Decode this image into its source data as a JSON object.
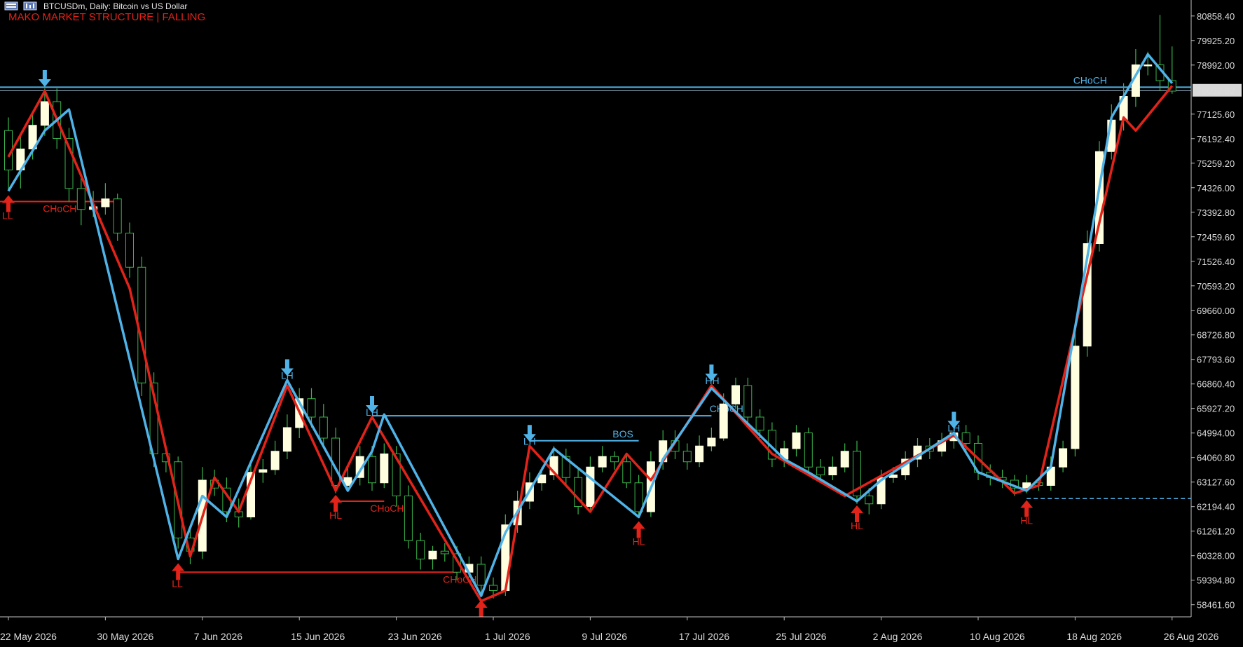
{
  "header": {
    "symbol_text": "BTCUSDm, Daily:  Bitcoin vs US Dollar",
    "indicator_text": "MAKO MARKET STRUCTURE | FALLING"
  },
  "colors": {
    "background": "#000000",
    "bull_candle": "#ffffe0",
    "bear_candle": "#000000",
    "wick": "#39b54a",
    "bull_line": "#4fb3e8",
    "bear_line": "#e2231a"
  },
  "chart_data": {
    "type": "candlestick",
    "price_scale": {
      "range": [
        58000,
        81200
      ],
      "labels": [
        "80858.40",
        "79925.20",
        "78992.00",
        "77125.60",
        "76192.40",
        "75259.20",
        "74326.00",
        "73392.80",
        "72459.60",
        "71526.40",
        "70593.20",
        "69660.00",
        "68726.80",
        "67793.60",
        "66860.40",
        "65927.20",
        "64994.00",
        "64060.80",
        "63127.60",
        "62194.40",
        "61261.20",
        "60328.00",
        "59394.80",
        "58461.60"
      ],
      "current_price": "78032.82"
    },
    "time_scale": {
      "labels": [
        {
          "i": 0,
          "text": "22 May 2026"
        },
        {
          "i": 8,
          "text": "30 May 2026"
        },
        {
          "i": 16,
          "text": "7 Jun 2026"
        },
        {
          "i": 24,
          "text": "15 Jun 2026"
        },
        {
          "i": 32,
          "text": "23 Jun 2026"
        },
        {
          "i": 40,
          "text": "1 Jul 2026"
        },
        {
          "i": 48,
          "text": "9 Jul 2026"
        },
        {
          "i": 56,
          "text": "17 Jul 2026"
        },
        {
          "i": 64,
          "text": "25 Jul 2026"
        },
        {
          "i": 72,
          "text": "2 Aug 2026"
        },
        {
          "i": 80,
          "text": "10 Aug 2026"
        },
        {
          "i": 88,
          "text": "18 Aug 2026"
        },
        {
          "i": 96,
          "text": "26 Aug 2026"
        }
      ]
    },
    "candles": [
      [
        76500,
        75000,
        77000,
        74200
      ],
      [
        75000,
        75800,
        76400,
        74300
      ],
      [
        75800,
        76700,
        77100,
        75400
      ],
      [
        76700,
        77600,
        78100,
        76300
      ],
      [
        77600,
        76200,
        78100,
        75800
      ],
      [
        76200,
        74300,
        76600,
        73800
      ],
      [
        74300,
        73500,
        74700,
        72900
      ],
      [
        73500,
        73600,
        74200,
        73200
      ],
      [
        73600,
        73900,
        74500,
        73300
      ],
      [
        73900,
        72600,
        74100,
        72300
      ],
      [
        72600,
        71300,
        73000,
        70900
      ],
      [
        71300,
        66900,
        71700,
        66400
      ],
      [
        66900,
        64200,
        67300,
        63700
      ],
      [
        64200,
        63900,
        64500,
        63500
      ],
      [
        63900,
        61000,
        64100,
        60600
      ],
      [
        61000,
        60500,
        61400,
        60000
      ],
      [
        60500,
        63200,
        63700,
        60200
      ],
      [
        63200,
        62900,
        63600,
        62600
      ],
      [
        62900,
        62000,
        63300,
        61600
      ],
      [
        62000,
        61800,
        62500,
        61400
      ],
      [
        61800,
        63500,
        63900,
        61700
      ],
      [
        63500,
        63600,
        64000,
        63100
      ],
      [
        63600,
        64300,
        64700,
        63400
      ],
      [
        64300,
        65200,
        65700,
        64000
      ],
      [
        65200,
        66300,
        66700,
        64800
      ],
      [
        66300,
        65600,
        66700,
        65200
      ],
      [
        65600,
        64800,
        66100,
        64500
      ],
      [
        64800,
        63000,
        65200,
        62700
      ],
      [
        63000,
        63300,
        63700,
        62800
      ],
      [
        63300,
        64100,
        64500,
        63000
      ],
      [
        64100,
        63100,
        64500,
        62800
      ],
      [
        63100,
        64200,
        64600,
        62900
      ],
      [
        64200,
        62600,
        64500,
        62200
      ],
      [
        62600,
        60900,
        63000,
        60600
      ],
      [
        60900,
        60200,
        61200,
        59800
      ],
      [
        60200,
        60500,
        60700,
        59800
      ],
      [
        60500,
        60400,
        60800,
        60100
      ],
      [
        60400,
        59700,
        60700,
        59400
      ],
      [
        59700,
        60000,
        60300,
        59500
      ],
      [
        60000,
        59200,
        60300,
        58800
      ],
      [
        59200,
        59000,
        59500,
        58700
      ],
      [
        59000,
        61500,
        61900,
        58800
      ],
      [
        61500,
        62400,
        62800,
        61200
      ],
      [
        62400,
        63100,
        63500,
        62100
      ],
      [
        63100,
        63400,
        63700,
        62800
      ],
      [
        63400,
        64100,
        64500,
        63200
      ],
      [
        64100,
        63300,
        64400,
        63000
      ],
      [
        63300,
        62200,
        63600,
        61900
      ],
      [
        62200,
        63700,
        64100,
        62000
      ],
      [
        63700,
        64100,
        64500,
        63500
      ],
      [
        64100,
        63900,
        64300,
        63600
      ],
      [
        63900,
        63100,
        64200,
        62900
      ],
      [
        63100,
        62000,
        63400,
        61800
      ],
      [
        62000,
        63900,
        64300,
        61800
      ],
      [
        63900,
        64700,
        65100,
        63600
      ],
      [
        64700,
        64300,
        65100,
        64000
      ],
      [
        64300,
        63900,
        64600,
        63600
      ],
      [
        63900,
        64500,
        64900,
        63700
      ],
      [
        64500,
        64800,
        65200,
        64300
      ],
      [
        64800,
        66100,
        66500,
        64700
      ],
      [
        66100,
        66800,
        67100,
        65900
      ],
      [
        66800,
        65600,
        67100,
        65200
      ],
      [
        65600,
        65100,
        65900,
        64800
      ],
      [
        65100,
        64000,
        65400,
        63700
      ],
      [
        64000,
        64400,
        64700,
        63700
      ],
      [
        64400,
        65000,
        65300,
        64100
      ],
      [
        65000,
        63700,
        65200,
        63400
      ],
      [
        63700,
        63400,
        64000,
        63100
      ],
      [
        63400,
        63700,
        64100,
        63200
      ],
      [
        63700,
        64300,
        64600,
        63500
      ],
      [
        64300,
        62600,
        64700,
        62300
      ],
      [
        62600,
        62300,
        62900,
        61900
      ],
      [
        62300,
        63300,
        63600,
        62100
      ],
      [
        63300,
        63400,
        63700,
        63100
      ],
      [
        63400,
        64000,
        64300,
        63200
      ],
      [
        64000,
        64500,
        64800,
        63700
      ],
      [
        64500,
        64300,
        64800,
        64000
      ],
      [
        64300,
        64700,
        65000,
        64100
      ],
      [
        64700,
        65000,
        65300,
        64400
      ],
      [
        65000,
        64600,
        65300,
        64200
      ],
      [
        64600,
        63500,
        64900,
        63200
      ],
      [
        63500,
        63300,
        63800,
        63000
      ],
      [
        63300,
        63200,
        63600,
        62900
      ],
      [
        63200,
        62900,
        63400,
        62600
      ],
      [
        62900,
        63100,
        63400,
        62700
      ],
      [
        63100,
        63000,
        63300,
        62800
      ],
      [
        63000,
        63700,
        64100,
        62800
      ],
      [
        63700,
        64400,
        64700,
        63500
      ],
      [
        64400,
        68300,
        68900,
        64100
      ],
      [
        68300,
        72200,
        72700,
        67900
      ],
      [
        72200,
        75700,
        76100,
        71900
      ],
      [
        75700,
        76900,
        77500,
        75400
      ],
      [
        76900,
        77800,
        78300,
        76500
      ],
      [
        77800,
        79000,
        79600,
        77400
      ],
      [
        79000,
        79000,
        79500,
        78600
      ],
      [
        79000,
        78400,
        80900,
        78000
      ],
      [
        78400,
        78000,
        79700,
        77900
      ]
    ],
    "bull_swing_line": [
      [
        0,
        74200
      ],
      [
        3,
        76500
      ],
      [
        5,
        77300
      ],
      [
        14,
        60200
      ],
      [
        16,
        62600
      ],
      [
        18,
        61800
      ],
      [
        23,
        67000
      ],
      [
        28,
        62800
      ],
      [
        30,
        64300
      ],
      [
        31,
        65700
      ],
      [
        39,
        58800
      ],
      [
        41,
        61200
      ],
      [
        45,
        64400
      ],
      [
        52,
        61800
      ],
      [
        54,
        64000
      ],
      [
        58,
        66700
      ],
      [
        64,
        64000
      ],
      [
        66,
        63500
      ],
      [
        70,
        62400
      ],
      [
        72,
        63200
      ],
      [
        78,
        65000
      ],
      [
        80,
        63500
      ],
      [
        84,
        62800
      ],
      [
        86,
        63700
      ],
      [
        88,
        69000
      ],
      [
        91,
        77000
      ],
      [
        94,
        79400
      ],
      [
        96,
        78300
      ]
    ],
    "bear_swing_line": [
      [
        0,
        75500
      ],
      [
        3,
        78000
      ],
      [
        10,
        70500
      ],
      [
        15,
        60300
      ],
      [
        17,
        63300
      ],
      [
        19,
        62000
      ],
      [
        23,
        66800
      ],
      [
        27,
        62800
      ],
      [
        30,
        65600
      ],
      [
        39,
        58600
      ],
      [
        41,
        59000
      ],
      [
        43,
        64500
      ],
      [
        48,
        62000
      ],
      [
        51,
        64200
      ],
      [
        53,
        63200
      ],
      [
        58,
        66800
      ],
      [
        63,
        64200
      ],
      [
        69,
        62600
      ],
      [
        78,
        64900
      ],
      [
        83,
        62700
      ],
      [
        85,
        63000
      ],
      [
        92,
        77000
      ],
      [
        93,
        76500
      ],
      [
        96,
        78200
      ]
    ],
    "annotations": [
      {
        "type": "arrow-down",
        "i": 3,
        "price": 78000,
        "label": ""
      },
      {
        "type": "arrow-down",
        "i": 23,
        "price": 67000,
        "label": "LH"
      },
      {
        "type": "arrow-down",
        "i": 30,
        "price": 65600,
        "label": "LH"
      },
      {
        "type": "arrow-down",
        "i": 43,
        "price": 64500,
        "label": "LH"
      },
      {
        "type": "arrow-down",
        "i": 58,
        "price": 66800,
        "label": "HH"
      },
      {
        "type": "arrow-down",
        "i": 78,
        "price": 65000,
        "label": "LH"
      },
      {
        "type": "arrow-up",
        "i": 0,
        "price": 74200,
        "label": "LL"
      },
      {
        "type": "arrow-up",
        "i": 14,
        "price": 60200,
        "label": "LL"
      },
      {
        "type": "arrow-up",
        "i": 27,
        "price": 62800,
        "label": "HL"
      },
      {
        "type": "arrow-up",
        "i": 39,
        "price": 58800,
        "label": ""
      },
      {
        "type": "arrow-up",
        "i": 52,
        "price": 61800,
        "label": "HL"
      },
      {
        "type": "arrow-up",
        "i": 70,
        "price": 62400,
        "label": "HL"
      },
      {
        "type": "arrow-up",
        "i": 84,
        "price": 62600,
        "label": "HL"
      }
    ],
    "levels": [
      {
        "color": "bull",
        "price": 78150,
        "from": -1,
        "to": 97,
        "label": "CHoCH",
        "label_i": 89
      },
      {
        "color": "bull",
        "price": 65650,
        "from": 30,
        "to": 58,
        "label": "CHoCH",
        "label_i": 59
      },
      {
        "color": "bull",
        "price": 64700,
        "from": 43,
        "to": 52,
        "label": "BOS",
        "label_i": 51
      },
      {
        "color": "bear",
        "price": 73800,
        "from": -1,
        "to": 9,
        "label": "CHoCH",
        "label_i": 4
      },
      {
        "color": "bear",
        "price": 62400,
        "from": 27,
        "to": 31,
        "label": "CHoCH",
        "label_i": 31
      },
      {
        "color": "bear",
        "price": 59700,
        "from": 14,
        "to": 37,
        "label": "CHoCH",
        "label_i": 37
      },
      {
        "color": "dashed",
        "price": 62500,
        "from": 84,
        "to": 97,
        "label": "",
        "label_i": 0
      }
    ]
  }
}
